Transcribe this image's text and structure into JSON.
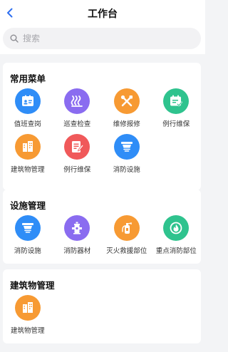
{
  "header": {
    "title": "工作台"
  },
  "search": {
    "placeholder": "搜索"
  },
  "colors": {
    "blue": "#2f8df7",
    "purple": "#8a6cf0",
    "orange": "#f79a33",
    "green": "#2fc38e",
    "red": "#f0595a"
  },
  "sections": [
    {
      "title": "常用菜单",
      "items": [
        {
          "label": "值班查岗",
          "icon": "id-card-icon"
        },
        {
          "label": "巡查检查",
          "icon": "patrol-waves-icon"
        },
        {
          "label": "维修报修",
          "icon": "tools-icon"
        },
        {
          "label": "例行维保",
          "icon": "calendar-check-icon"
        },
        {
          "label": "建筑物管理",
          "icon": "building-icon"
        },
        {
          "label": "例行维保",
          "icon": "report-icon"
        },
        {
          "label": "消防设施",
          "icon": "smoke-detector-icon"
        }
      ]
    },
    {
      "title": "设施管理",
      "items": [
        {
          "label": "消防设施",
          "icon": "smoke-detector-icon"
        },
        {
          "label": "消防器材",
          "icon": "hydrant-icon"
        },
        {
          "label": "灭火救援部位",
          "icon": "extinguisher-icon"
        },
        {
          "label": "重点消防部位",
          "icon": "flame-icon"
        }
      ]
    },
    {
      "title": "建筑物管理",
      "items": [
        {
          "label": "建筑物管理",
          "icon": "building-icon"
        }
      ]
    }
  ]
}
